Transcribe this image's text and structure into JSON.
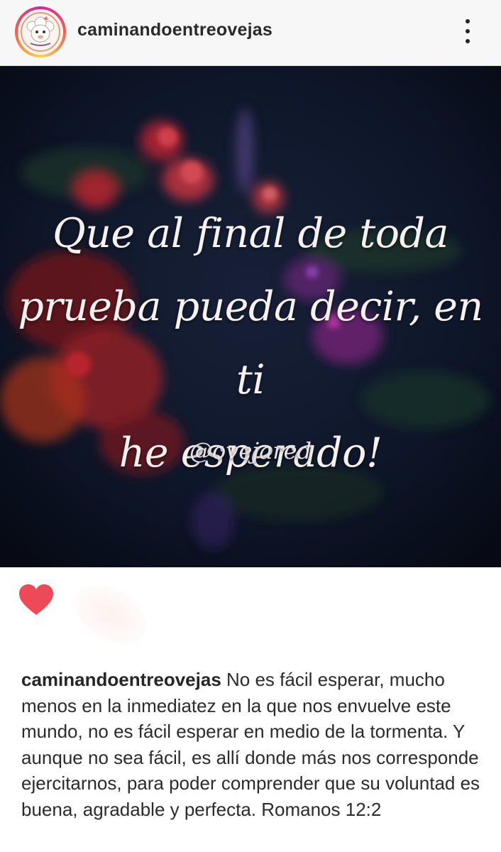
{
  "header": {
    "username": "caminandoentreovejas",
    "avatar_icon": "sheep-logo",
    "more_icon": "more-vertical-icon"
  },
  "post": {
    "quote_lines": [
      "Que al final de toda",
      "prueba pueda decir, en ti",
      "he esperado!"
    ],
    "handle": "@ovejared"
  },
  "actions": {
    "like_icon": "heart-filled-icon",
    "like_color": "#ed4956"
  },
  "caption": {
    "username": "caminandoentreovejas",
    "text": "No es fácil esperar, mucho menos en la inmediatez en la que nos envuelve este mundo, no es fácil esperar en medio de la tormenta. Y aunque no sea fácil, es allí donde más nos corresponde ejercitarnos, para poder comprender que su voluntad es buena, agradable y perfecta. Romanos 12:2"
  }
}
